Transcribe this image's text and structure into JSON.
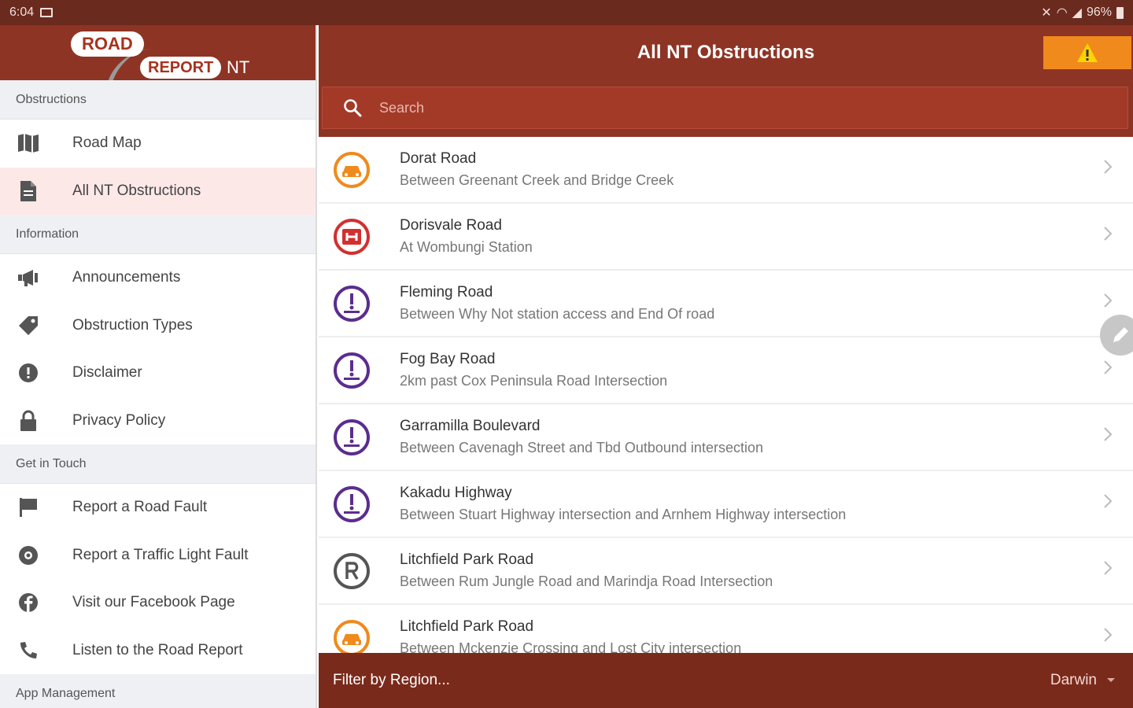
{
  "status_bar": {
    "time": "6:04",
    "battery": "96%"
  },
  "sidebar": {
    "logo": {
      "road": "ROAD",
      "report": "REPORT",
      "nt": "NT"
    },
    "sections": [
      {
        "header": "Obstructions",
        "items": [
          {
            "label": "Road Map",
            "icon": "map-icon"
          },
          {
            "label": "All NT Obstructions",
            "icon": "document-icon",
            "active": true
          }
        ]
      },
      {
        "header": "Information",
        "items": [
          {
            "label": "Announcements",
            "icon": "megaphone-icon"
          },
          {
            "label": "Obstruction Types",
            "icon": "tag-icon"
          },
          {
            "label": "Disclaimer",
            "icon": "alert-circle-icon"
          },
          {
            "label": "Privacy Policy",
            "icon": "lock-icon"
          }
        ]
      },
      {
        "header": "Get in Touch",
        "items": [
          {
            "label": "Report a Road Fault",
            "icon": "flag-icon"
          },
          {
            "label": "Report a Traffic Light Fault",
            "icon": "traffic-light-icon"
          },
          {
            "label": "Visit our Facebook Page",
            "icon": "facebook-icon"
          },
          {
            "label": "Listen to the Road Report",
            "icon": "phone-icon"
          }
        ]
      },
      {
        "header": "App Management",
        "items": []
      }
    ]
  },
  "header": {
    "title": "All NT Obstructions"
  },
  "search": {
    "placeholder": "Search",
    "value": ""
  },
  "obstructions": [
    {
      "title": "Dorat Road",
      "subtitle": "Between Greenant Creek and Bridge Creek",
      "type": "car",
      "color": "#f08a1c"
    },
    {
      "title": "Dorisvale Road",
      "subtitle": "At Wombungi Station",
      "type": "closed",
      "color": "#d32f2f"
    },
    {
      "title": "Fleming Road",
      "subtitle": "Between Why Not station access and End Of road",
      "type": "caution",
      "color": "#5b2d8e"
    },
    {
      "title": "Fog Bay Road",
      "subtitle": "2km past Cox Peninsula Road Intersection",
      "type": "caution",
      "color": "#5b2d8e"
    },
    {
      "title": "Garramilla Boulevard",
      "subtitle": "Between Cavenagh Street and Tbd Outbound intersection",
      "type": "caution",
      "color": "#5b2d8e"
    },
    {
      "title": "Kakadu Highway",
      "subtitle": "Between Stuart Highway intersection and Arnhem Highway intersection",
      "type": "caution",
      "color": "#5b2d8e"
    },
    {
      "title": "Litchfield Park Road",
      "subtitle": "Between Rum Jungle Road and Marindja Road Intersection",
      "type": "restricted",
      "color": "#555555"
    },
    {
      "title": "Litchfield Park Road",
      "subtitle": "Between Mckenzie Crossing and Lost City intersection",
      "type": "car",
      "color": "#f08a1c"
    }
  ],
  "footer": {
    "filter_label": "Filter by Region...",
    "region_value": "Darwin"
  },
  "colors": {
    "brand": "#8e3424",
    "statusbar": "#6b2a1e",
    "warning": "#f08a1c",
    "footer": "#7a2a1b"
  }
}
